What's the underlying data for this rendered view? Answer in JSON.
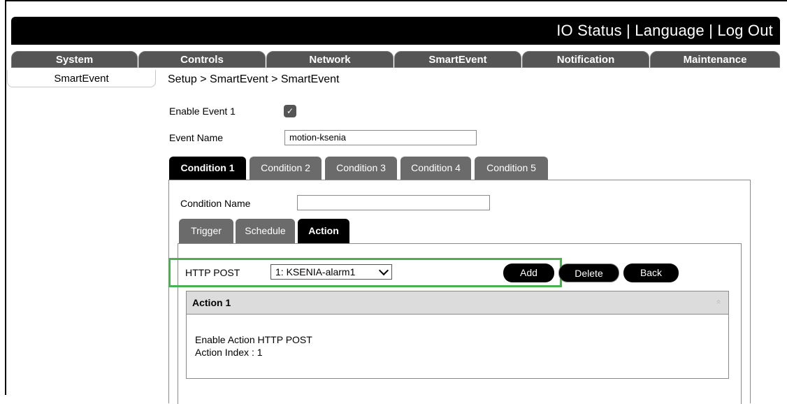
{
  "header": {
    "links": [
      "IO Status",
      "Language",
      "Log Out"
    ],
    "separator": " | "
  },
  "menu": {
    "items": [
      "System",
      "Controls",
      "Network",
      "SmartEvent",
      "Notification",
      "Maintenance"
    ]
  },
  "sidebar": {
    "items": [
      "SmartEvent"
    ]
  },
  "breadcrumb": "Setup > SmartEvent > SmartEvent",
  "event": {
    "enable_label": "Enable Event 1",
    "enable_checked": true,
    "checkmark": "✓",
    "name_label": "Event Name",
    "name_value": "motion-ksenia"
  },
  "condition_tabs": {
    "items": [
      "Condition 1",
      "Condition 2",
      "Condition 3",
      "Condition 4",
      "Condition 5"
    ],
    "active": "Condition 1"
  },
  "condition": {
    "name_label": "Condition Name",
    "name_value": ""
  },
  "sub_tabs": {
    "items": [
      "Trigger",
      "Schedule",
      "Action"
    ],
    "active": "Action"
  },
  "action_row": {
    "type_label": "HTTP POST",
    "selected_option": "1: KSENIA-alarm1",
    "buttons": [
      "Add",
      "Delete",
      "Back"
    ]
  },
  "action_box": {
    "title": "Action 1",
    "collapse_glyph": "«",
    "lines": [
      "Enable Action HTTP POST",
      "Action Index : 1"
    ]
  },
  "colors": {
    "highlight": "#4caf50",
    "menu_bg": "#555555",
    "topbar_bg": "#000000"
  }
}
